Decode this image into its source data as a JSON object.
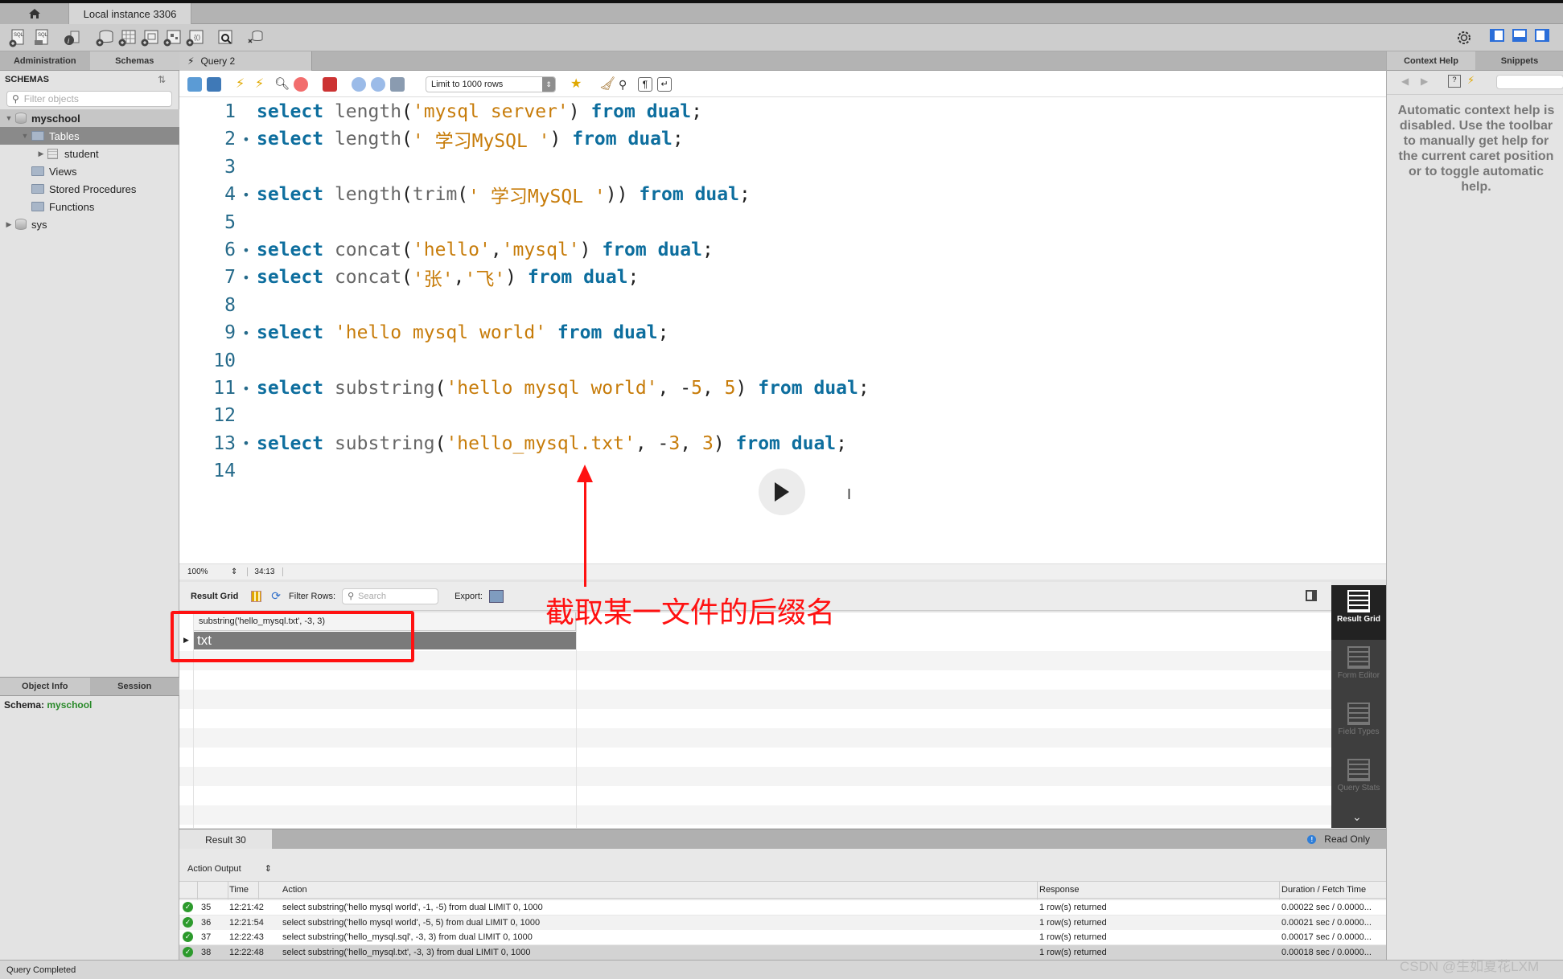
{
  "window": {
    "home_tab_icon": "home-icon",
    "instance_tab": "Local instance 3306"
  },
  "toolbar": {
    "icons": [
      "new-sql-tab-icon",
      "open-sql-file-icon",
      "inspector-icon",
      "create-schema-icon",
      "create-table-icon",
      "create-view-icon",
      "create-procedure-icon",
      "create-function-icon",
      "search-table-data-icon",
      "reconnect-icon"
    ],
    "right_icons": [
      "settings-icon",
      "toggle-sidebar-icon",
      "toggle-output-icon",
      "toggle-secondary-sidebar-icon"
    ]
  },
  "sidebar": {
    "tabs": [
      {
        "label": "Administration",
        "active": false
      },
      {
        "label": "Schemas",
        "active": true
      }
    ],
    "header": "SCHEMAS",
    "filter_placeholder": "Filter objects",
    "tree": [
      {
        "label": "myschool",
        "level": 0,
        "expanded": true,
        "icon": "database-icon",
        "bold": true
      },
      {
        "label": "Tables",
        "level": 1,
        "expanded": true,
        "icon": "folder-icon",
        "selected": true
      },
      {
        "label": "student",
        "level": 2,
        "expanded": false,
        "icon": "table-icon"
      },
      {
        "label": "Views",
        "level": 1,
        "icon": "folder-icon"
      },
      {
        "label": "Stored Procedures",
        "level": 1,
        "icon": "folder-icon"
      },
      {
        "label": "Functions",
        "level": 1,
        "icon": "folder-icon"
      },
      {
        "label": "sys",
        "level": 0,
        "expanded": false,
        "icon": "database-icon"
      }
    ],
    "info_tabs": [
      {
        "label": "Object Info",
        "active": true
      },
      {
        "label": "Session",
        "active": false
      }
    ],
    "schema_label": "Schema:",
    "schema_value": "myschool"
  },
  "query_tab": {
    "label": "Query 2"
  },
  "editor_toolbar": {
    "limit_select": "Limit to 1000 rows"
  },
  "editor": {
    "lines": [
      {
        "n": "1",
        "dot": false,
        "tokens": [
          [
            "kw",
            "select"
          ],
          [
            "pun",
            " "
          ],
          [
            "fn",
            "length"
          ],
          [
            "pun",
            "("
          ],
          [
            "str",
            "'mysql server'"
          ],
          [
            "pun",
            ") "
          ],
          [
            "kw",
            "from"
          ],
          [
            "pun",
            " "
          ],
          [
            "kw",
            "dual"
          ],
          [
            "pun",
            ";"
          ]
        ]
      },
      {
        "n": "2",
        "dot": true,
        "tokens": [
          [
            "kw",
            "select"
          ],
          [
            "pun",
            " "
          ],
          [
            "fn",
            "length"
          ],
          [
            "pun",
            "("
          ],
          [
            "str",
            "' 学习MySQL '"
          ],
          [
            "pun",
            ") "
          ],
          [
            "kw",
            "from"
          ],
          [
            "pun",
            " "
          ],
          [
            "kw",
            "dual"
          ],
          [
            "pun",
            ";"
          ]
        ]
      },
      {
        "n": "3",
        "dot": false,
        "tokens": []
      },
      {
        "n": "4",
        "dot": true,
        "tokens": [
          [
            "kw",
            "select"
          ],
          [
            "pun",
            " "
          ],
          [
            "fn",
            "length"
          ],
          [
            "pun",
            "("
          ],
          [
            "fn",
            "trim"
          ],
          [
            "pun",
            "("
          ],
          [
            "str",
            "' 学习MySQL '"
          ],
          [
            "pun",
            ")) "
          ],
          [
            "kw",
            "from"
          ],
          [
            "pun",
            " "
          ],
          [
            "kw",
            "dual"
          ],
          [
            "pun",
            ";"
          ]
        ]
      },
      {
        "n": "5",
        "dot": false,
        "tokens": []
      },
      {
        "n": "6",
        "dot": true,
        "tokens": [
          [
            "kw",
            "select"
          ],
          [
            "pun",
            " "
          ],
          [
            "fn",
            "concat"
          ],
          [
            "pun",
            "("
          ],
          [
            "str",
            "'hello'"
          ],
          [
            "pun",
            ","
          ],
          [
            "str",
            "'mysql'"
          ],
          [
            "pun",
            ") "
          ],
          [
            "kw",
            "from"
          ],
          [
            "pun",
            " "
          ],
          [
            "kw",
            "dual"
          ],
          [
            "pun",
            ";"
          ]
        ]
      },
      {
        "n": "7",
        "dot": true,
        "tokens": [
          [
            "kw",
            "select"
          ],
          [
            "pun",
            " "
          ],
          [
            "fn",
            "concat"
          ],
          [
            "pun",
            "("
          ],
          [
            "str",
            "'张'"
          ],
          [
            "pun",
            ","
          ],
          [
            "str",
            "'飞'"
          ],
          [
            "pun",
            ") "
          ],
          [
            "kw",
            "from"
          ],
          [
            "pun",
            " "
          ],
          [
            "kw",
            "dual"
          ],
          [
            "pun",
            ";"
          ]
        ]
      },
      {
        "n": "8",
        "dot": false,
        "tokens": []
      },
      {
        "n": "9",
        "dot": true,
        "tokens": [
          [
            "kw",
            "select"
          ],
          [
            "pun",
            " "
          ],
          [
            "str",
            "'hello mysql world'"
          ],
          [
            "pun",
            " "
          ],
          [
            "kw",
            "from"
          ],
          [
            "pun",
            " "
          ],
          [
            "kw",
            "dual"
          ],
          [
            "pun",
            ";"
          ]
        ]
      },
      {
        "n": "10",
        "dot": false,
        "tokens": []
      },
      {
        "n": "11",
        "dot": true,
        "tokens": [
          [
            "kw",
            "select"
          ],
          [
            "pun",
            " "
          ],
          [
            "fn",
            "substring"
          ],
          [
            "pun",
            "("
          ],
          [
            "str",
            "'hello mysql world'"
          ],
          [
            "pun",
            ", -"
          ],
          [
            "num",
            "5"
          ],
          [
            "pun",
            ", "
          ],
          [
            "num",
            "5"
          ],
          [
            "pun",
            ") "
          ],
          [
            "kw",
            "from"
          ],
          [
            "pun",
            " "
          ],
          [
            "kw",
            "dual"
          ],
          [
            "pun",
            ";"
          ]
        ]
      },
      {
        "n": "12",
        "dot": false,
        "tokens": []
      },
      {
        "n": "13",
        "dot": true,
        "tokens": [
          [
            "kw",
            "select"
          ],
          [
            "pun",
            " "
          ],
          [
            "fn",
            "substring"
          ],
          [
            "pun",
            "("
          ],
          [
            "str",
            "'hello_mysql.txt'"
          ],
          [
            "pun",
            ", -"
          ],
          [
            "num",
            "3"
          ],
          [
            "pun",
            ", "
          ],
          [
            "num",
            "3"
          ],
          [
            "pun",
            ") "
          ],
          [
            "kw",
            "from"
          ],
          [
            "pun",
            " "
          ],
          [
            "kw",
            "dual"
          ],
          [
            "pun",
            ";"
          ]
        ]
      },
      {
        "n": "14",
        "dot": false,
        "tokens": []
      }
    ]
  },
  "editor_status": {
    "zoom": "100%",
    "cursor": "34:13"
  },
  "result_toolbar": {
    "label": "Result Grid",
    "filter_label": "Filter Rows:",
    "search_placeholder": "Search",
    "export_label": "Export:"
  },
  "result_grid": {
    "columns": [
      "substring('hello_mysql.txt', -3, 3)"
    ],
    "rows": [
      [
        "txt"
      ]
    ]
  },
  "annotation": {
    "text": "截取某一文件的后缀名",
    "color": "#ff1111"
  },
  "result_side": [
    {
      "label": "Result Grid",
      "active": true,
      "icon": "result-grid-icon"
    },
    {
      "label": "Form Editor",
      "active": false,
      "icon": "form-editor-icon"
    },
    {
      "label": "Field Types",
      "active": false,
      "icon": "field-types-icon"
    },
    {
      "label": "Query Stats",
      "active": false,
      "icon": "query-stats-icon"
    }
  ],
  "result_tabs": {
    "label": "Result 30",
    "read_only": "Read Only"
  },
  "action_output": {
    "selector": "Action Output",
    "columns": [
      "",
      "Time",
      "Action",
      "Response",
      "Duration / Fetch Time"
    ],
    "rows": [
      {
        "id": "35",
        "time": "12:21:42",
        "action": "select substring('hello mysql world', -1, -5) from dual LIMIT 0, 1000",
        "response": "1 row(s) returned",
        "duration": "0.00022 sec / 0.0000..."
      },
      {
        "id": "36",
        "time": "12:21:54",
        "action": "select substring('hello mysql world', -5, 5) from dual LIMIT 0, 1000",
        "response": "1 row(s) returned",
        "duration": "0.00021 sec / 0.0000..."
      },
      {
        "id": "37",
        "time": "12:22:43",
        "action": "select substring('hello_mysql.sql', -3, 3) from dual LIMIT 0, 1000",
        "response": "1 row(s) returned",
        "duration": "0.00017 sec / 0.0000..."
      },
      {
        "id": "38",
        "time": "12:22:48",
        "action": "select substring('hello_mysql.txt', -3, 3) from dual LIMIT 0, 1000",
        "response": "1 row(s) returned",
        "duration": "0.00018 sec / 0.0000..."
      }
    ]
  },
  "context_help": {
    "tabs": [
      {
        "label": "Context Help",
        "active": true
      },
      {
        "label": "Snippets",
        "active": false
      }
    ],
    "message": "Automatic context help is disabled. Use the toolbar to manually get help for the current caret position or to toggle automatic help."
  },
  "status_bar": {
    "text": "Query Completed"
  },
  "watermark": "CSDN @生如夏花LXM"
}
